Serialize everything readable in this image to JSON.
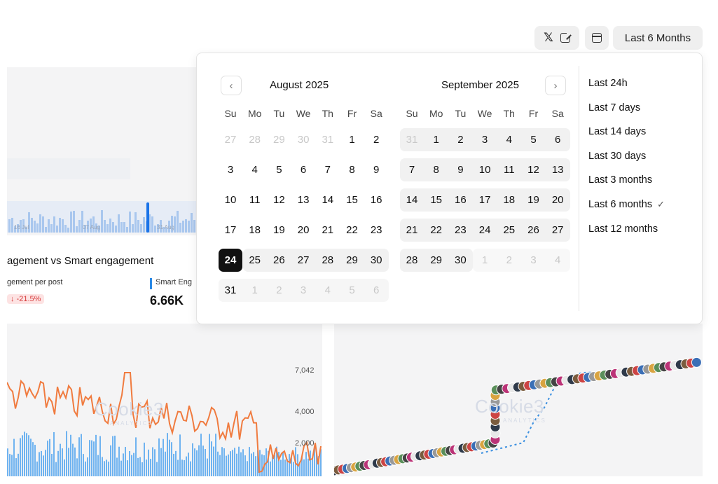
{
  "toolbar": {
    "x_label": "𝕏",
    "range_label": "Last 6 Months"
  },
  "dashboard": {
    "mini_chart_labels": [
      "16 Jul",
      "07 Aug",
      "31 Aug"
    ],
    "engagement_title": "agement vs Smart engagement",
    "metric_left_label": "gement per post",
    "metric_left_change": "↓ -21.5%",
    "metric_right_label": "Smart Eng",
    "metric_right_value": "6.66K",
    "y_ticks": [
      "7,042",
      "4,000",
      "2,000"
    ],
    "watermark": "Cookie3",
    "watermark_sub": "ANALYTICS",
    "colors": {
      "orange_line": "#f07b3f",
      "blue_bars": "#6fb3f0",
      "accent": "#1a73e8"
    }
  },
  "calendar": {
    "prev_icon": "‹",
    "next_icon": "›",
    "weekdays": [
      "Su",
      "Mo",
      "Tu",
      "We",
      "Th",
      "Fr",
      "Sa"
    ],
    "months": [
      {
        "title": "August 2025",
        "weeks": [
          [
            "27",
            "28",
            "29",
            "30",
            "31",
            "1",
            "2"
          ],
          [
            "3",
            "4",
            "5",
            "6",
            "7",
            "8",
            "9"
          ],
          [
            "10",
            "11",
            "12",
            "13",
            "14",
            "15",
            "16"
          ],
          [
            "17",
            "18",
            "19",
            "20",
            "21",
            "22",
            "23"
          ],
          [
            "24",
            "25",
            "26",
            "27",
            "28",
            "29",
            "30"
          ],
          [
            "31",
            "1",
            "2",
            "3",
            "4",
            "5",
            "6"
          ]
        ]
      },
      {
        "title": "September 2025",
        "weeks": [
          [
            "31",
            "1",
            "2",
            "3",
            "4",
            "5",
            "6"
          ],
          [
            "7",
            "8",
            "9",
            "10",
            "11",
            "12",
            "13"
          ],
          [
            "14",
            "15",
            "16",
            "17",
            "18",
            "19",
            "20"
          ],
          [
            "21",
            "22",
            "23",
            "24",
            "25",
            "26",
            "27"
          ],
          [
            "28",
            "29",
            "30",
            "1",
            "2",
            "3",
            "4"
          ]
        ]
      }
    ],
    "selected_day": "24"
  },
  "presets": {
    "items": [
      "Last 24h",
      "Last 7 days",
      "Last 14 days",
      "Last 30 days",
      "Last 3 months",
      "Last 6 months",
      "Last 12 months"
    ],
    "active": "Last 6 months",
    "check_icon": "✓"
  }
}
